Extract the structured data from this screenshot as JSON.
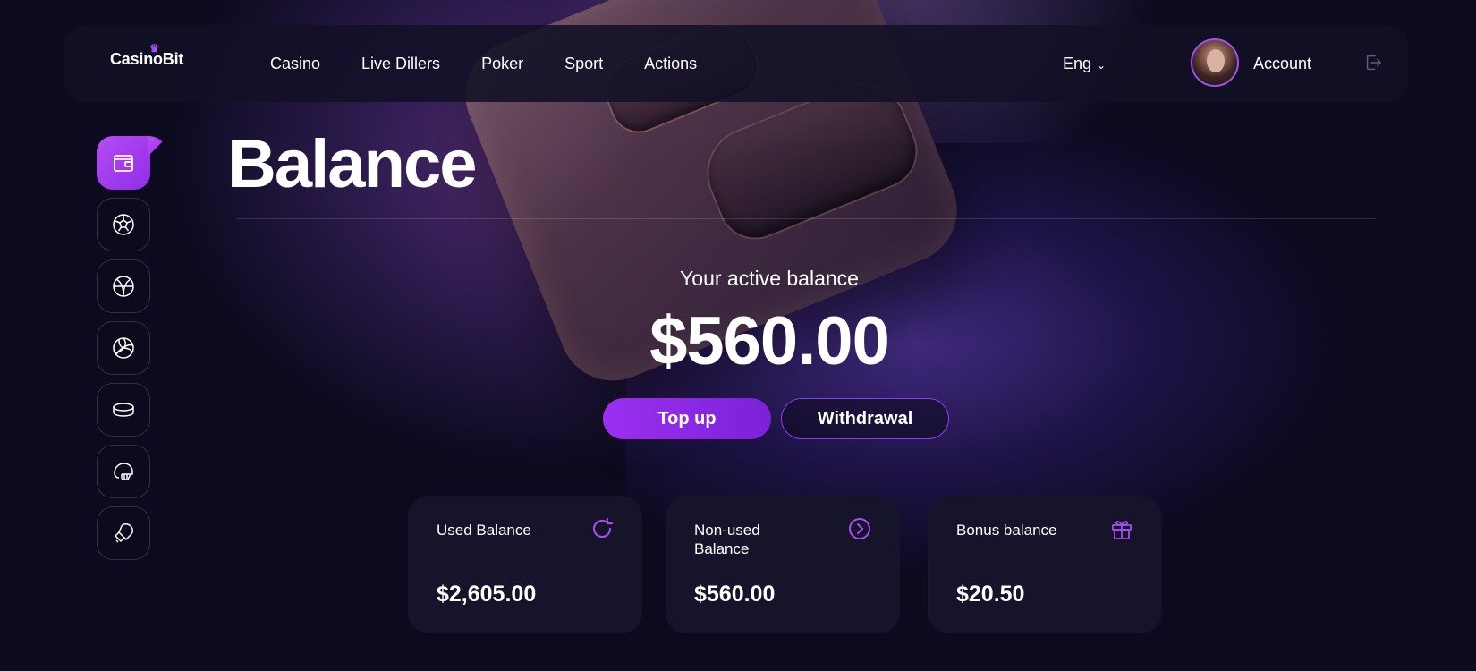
{
  "header": {
    "logo": "CasinoBit",
    "nav": [
      "Casino",
      "Live Dillers",
      "Poker",
      "Sport",
      "Actions"
    ],
    "language": "Eng",
    "account_label": "Account"
  },
  "sidebar": {
    "items": [
      {
        "icon": "wallet-icon",
        "active": true
      },
      {
        "icon": "soccer-ball-icon",
        "active": false
      },
      {
        "icon": "basketball-icon",
        "active": false
      },
      {
        "icon": "volleyball-icon",
        "active": false
      },
      {
        "icon": "hockey-puck-icon",
        "active": false
      },
      {
        "icon": "football-helmet-icon",
        "active": false
      },
      {
        "icon": "boxing-glove-icon",
        "active": false
      }
    ]
  },
  "page": {
    "title": "Balance"
  },
  "balance": {
    "active_label": "Your active balance",
    "active_amount": "$560.00",
    "topup_label": "Top up",
    "withdraw_label": "Withdrawal"
  },
  "cards": [
    {
      "label": "Used Balance",
      "amount": "$2,605.00",
      "icon": "refresh-icon"
    },
    {
      "label": "Non-used Balance",
      "amount": "$560.00",
      "icon": "arrow-circle-icon"
    },
    {
      "label": "Bonus balance",
      "amount": "$20.50",
      "icon": "gift-icon"
    }
  ],
  "colors": {
    "accent": "#9d2ff0",
    "background": "#0b0a1e",
    "card": "#16142b"
  }
}
